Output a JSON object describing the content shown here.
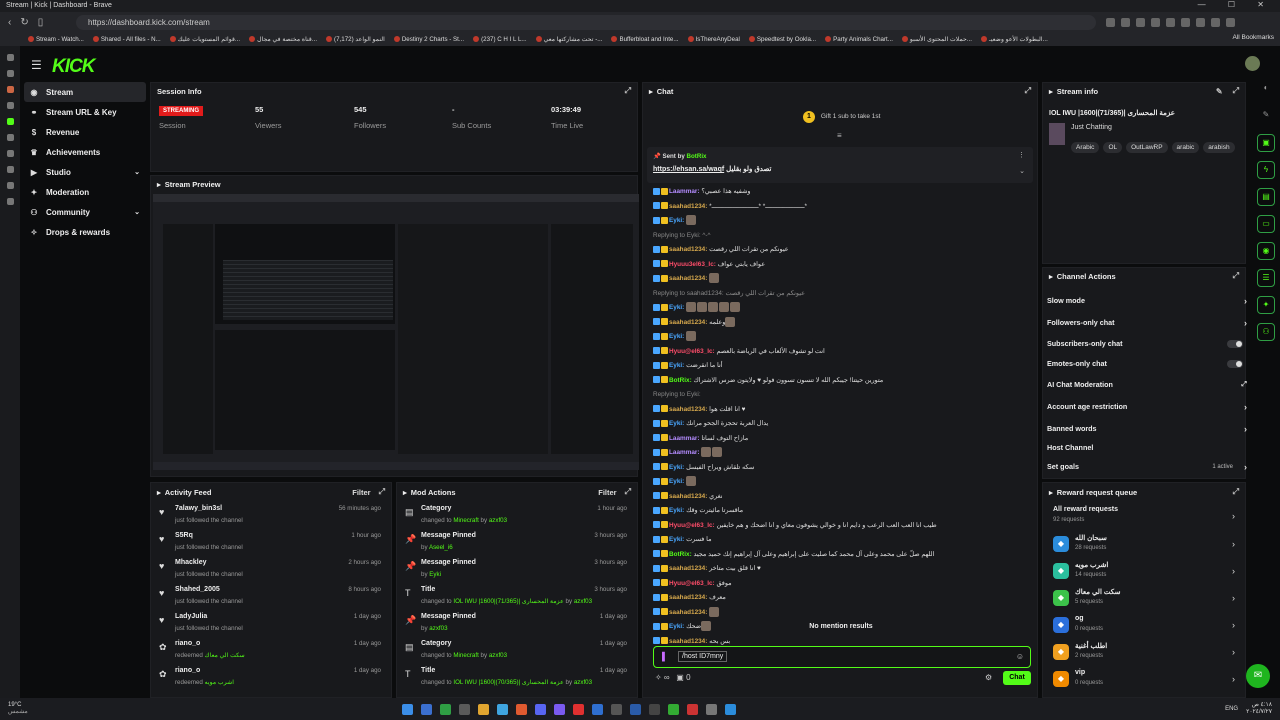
{
  "browser": {
    "title": "Stream | Kick | Dashboard - Brave",
    "url": "https://dashboard.kick.com/stream",
    "bookmarks": [
      "Stream - Watch...",
      "Shared - All files - N...",
      "قوائم المستويات عليك...",
      "قناة مختصة في مجال...",
      "النمو الواعد (7,172)",
      "Destiny 2 Charts - St...",
      "(237) C H I L L...",
      "تحت مشاركتها معي -...",
      "Bufferbloat and Inte...",
      "IsThereAnyDeal",
      "Speedtest by Ookla...",
      "Party Animals Chart...",
      "حملات المحتوى الأسبو...",
      "البطولات الأعو وضعيـ..."
    ],
    "all_bookmarks": "All Bookmarks"
  },
  "sidebar": {
    "items": [
      {
        "label": "Stream",
        "icon": "signal"
      },
      {
        "label": "Stream URL & Key",
        "icon": "link"
      },
      {
        "label": "Revenue",
        "icon": "dollar"
      },
      {
        "label": "Achievements",
        "icon": "trophy"
      },
      {
        "label": "Studio",
        "icon": "studio"
      },
      {
        "label": "Moderation",
        "icon": "sword"
      },
      {
        "label": "Community",
        "icon": "users"
      },
      {
        "label": "Drops & rewards",
        "icon": "gift"
      }
    ]
  },
  "session": {
    "title": "Session Info",
    "status": "STREAMING",
    "status_label": "Session",
    "viewers": "55",
    "viewers_label": "Viewers",
    "followers": "545",
    "followers_label": "Followers",
    "subs": "-",
    "subs_label": "Sub Counts",
    "time": "03:39:49",
    "time_label": "Time Live"
  },
  "preview": {
    "title": "Stream Preview"
  },
  "activity": {
    "title": "Activity Feed",
    "filter": "Filter",
    "items": [
      {
        "name": "7alawy_bin3sl",
        "sub": "just followed the channel",
        "time": "56 minutes ago",
        "icon": "heart"
      },
      {
        "name": "S5Rq",
        "sub": "just followed the channel",
        "time": "1 hour ago",
        "icon": "heart"
      },
      {
        "name": "Mhackley",
        "sub": "just followed the channel",
        "time": "2 hours ago",
        "icon": "heart"
      },
      {
        "name": "Shahed_2005",
        "sub": "just followed the channel",
        "time": "8 hours ago",
        "icon": "heart"
      },
      {
        "name": "LadyJulia",
        "sub": "just followed the channel",
        "time": "1 day ago",
        "icon": "heart"
      },
      {
        "name": "riano_o",
        "sub_prefix": "redeemed",
        "sub_green": "سكت الي معاك",
        "time": "1 day ago",
        "icon": "reward"
      },
      {
        "name": "riano_o",
        "sub_prefix": "redeemed",
        "sub_green": "اشرب مويه",
        "time": "1 day ago",
        "icon": "reward"
      }
    ]
  },
  "modactions": {
    "title": "Mod Actions",
    "filter": "Filter",
    "items": [
      {
        "name": "Category",
        "pre": "changed to",
        "green": "Minecraft",
        "by": "by",
        "who": "azxf03",
        "time": "1 hour ago",
        "icon": "category"
      },
      {
        "name": "Message Pinned",
        "pre": "",
        "green": "",
        "by": "by",
        "who": "Aseel_i6",
        "time": "3 hours ago",
        "icon": "pin"
      },
      {
        "name": "Message Pinned",
        "pre": "",
        "green": "",
        "by": "by",
        "who": "Eyki",
        "time": "3 hours ago",
        "icon": "pin"
      },
      {
        "name": "Title",
        "pre": "changed to",
        "green": "IOL IWU |1600|(71/365)| عزمة المحسارى",
        "by": "by",
        "who": "azxf03",
        "time": "3 hours ago",
        "icon": "title"
      },
      {
        "name": "Message Pinned",
        "pre": "",
        "green": "",
        "by": "by",
        "who": "azxf03",
        "time": "1 day ago",
        "icon": "pin"
      },
      {
        "name": "Category",
        "pre": "changed to",
        "green": "Minecraft",
        "by": "by",
        "who": "azxf03",
        "time": "1 day ago",
        "icon": "category"
      },
      {
        "name": "Title",
        "pre": "changed to",
        "green": "IOL IWU |1600|(70/365)| عزمة المحسارى",
        "by": "by",
        "who": "azxf03",
        "time": "1 day ago",
        "icon": "title"
      }
    ]
  },
  "chat": {
    "title": "Chat",
    "gift_text": "Gift 1 sub to take 1st",
    "gift_count": "1",
    "pinned_label": "Sent by",
    "pinned_by": "BotRix",
    "pinned_url": "https://ehsan.sa/waqf",
    "pinned_text": "تصدق ولو بقليل",
    "messages": [
      {
        "user": "Laammar:",
        "color": "#b48cff",
        "text": "وشفيه هذا عصبي؟"
      },
      {
        "user": "saahad1234:",
        "color": "#d7a94d",
        "text": "*ـــــــــــــــــــــ* *ـــــــــــــــــــــــــ*"
      },
      {
        "user": "Eyki:",
        "color": "#4aa7ff",
        "text": "",
        "emotes": 1
      },
      {
        "user": "",
        "color": "#777",
        "text": "Replying to Eyki: ^-^"
      },
      {
        "user": "saahad1234:",
        "color": "#d7a94d",
        "text": "عيونكم من تقرات اللي رقصت"
      },
      {
        "user": "Hyuuu3el63_Ic:",
        "color": "#ff4d6a",
        "text": "عواف يابتي عواف"
      },
      {
        "user": "saahad1234:",
        "color": "#d7a94d",
        "text": "",
        "emotes": 1
      },
      {
        "user": "",
        "color": "#777",
        "text": "Replying to saahad1234: عيونكم من تقرات اللي رقصت"
      },
      {
        "user": "Eyki:",
        "color": "#4aa7ff",
        "text": "",
        "emotes": 5
      },
      {
        "user": "saahad1234:",
        "color": "#d7a94d",
        "text": "وعلمه",
        "emotes": 1
      },
      {
        "user": "Eyki:",
        "color": "#4aa7ff",
        "text": "",
        "emotes": 1
      },
      {
        "user": "Hyuu@el63_Ic:",
        "color": "#ff4d6a",
        "text": "انت لو تشوف الألعاب في الرياضة بالعصم"
      },
      {
        "user": "Eyki:",
        "color": "#4aa7ff",
        "text": "أنا ما انقرضت"
      },
      {
        "user": "BotRix:",
        "color": "#53fc18",
        "text": "متورين حيتنا! جيبكم الله لا تنسون تسوون فولو ♥ ولايتون ضرس الاشتراك"
      },
      {
        "user": "",
        "color": "#777",
        "text": "Replying to Eyki:"
      },
      {
        "user": "saahad1234:",
        "color": "#d7a94d",
        "text": "انا اقلت هوا ♥"
      },
      {
        "user": "Eyki:",
        "color": "#4aa7ff",
        "text": "يدال العربة تحجزة الجحو مرانك"
      },
      {
        "user": "Laammar:",
        "color": "#b48cff",
        "text": "مازاح التوف لساتا"
      },
      {
        "user": "Laammar:",
        "color": "#b48cff",
        "text": "",
        "emotes": 2
      },
      {
        "user": "Eyki:",
        "color": "#4aa7ff",
        "text": "سكه تلقاش ويراح الفيسل"
      },
      {
        "user": "Eyki:",
        "color": "#4aa7ff",
        "text": "",
        "emotes": 1
      },
      {
        "user": "saahad1234:",
        "color": "#d7a94d",
        "text": "نغري"
      },
      {
        "user": "Eyki:",
        "color": "#4aa7ff",
        "text": "ماقسرتا مائيترت وقك"
      },
      {
        "user": "Hyuu@el63_Ic:",
        "color": "#ff4d6a",
        "text": "طيب انا العب العب الرعب و دايم انا و خوالي يشوفون معاي و انا اضحك و هم خايفين"
      },
      {
        "user": "Eyki:",
        "color": "#4aa7ff",
        "text": "ما فسرت"
      },
      {
        "user": "BotRix:",
        "color": "#53fc18",
        "text": "اللهم صلّ على محمد وعلى آل محمد كما صليت على إبراهيم وعلى آل إبراهيم إنك حميد مجيد"
      },
      {
        "user": "saahad1234:",
        "color": "#d7a94d",
        "text": "انا قلق بيت متاخر ♥"
      },
      {
        "user": "Hyuu@el63_Ic:",
        "color": "#ff4d6a",
        "text": "موفق"
      },
      {
        "user": "saahad1234:",
        "color": "#d7a94d",
        "text": "معرف"
      },
      {
        "user": "saahad1234:",
        "color": "#d7a94d",
        "text": "",
        "emotes": 1
      },
      {
        "user": "Eyki:",
        "color": "#4aa7ff",
        "text": "ضحك",
        "emotes": 1
      },
      {
        "user": "saahad1234:",
        "color": "#d7a94d",
        "text": "بس بحه"
      }
    ],
    "no_mention": "No mention results",
    "input_value": "/host ID7mny",
    "send": "Chat",
    "count": "0"
  },
  "streaminfo": {
    "title": "Stream info",
    "stream_title": "IOL IWU |1600|(71/365)| عزمة المحسارى",
    "category": "Just Chatting",
    "tags": [
      "Arabic",
      "OL",
      "OutLawRP",
      "arabic",
      "arabish"
    ]
  },
  "channelactions": {
    "title": "Channel Actions",
    "items": [
      {
        "label": "Slow mode",
        "type": "chevron"
      },
      {
        "label": "Followers-only chat",
        "type": "chevron"
      },
      {
        "label": "Subscribers-only chat",
        "type": "toggle"
      },
      {
        "label": "Emotes-only chat",
        "type": "toggle"
      },
      {
        "label": "AI Chat Moderation",
        "type": "external"
      },
      {
        "label": "Account age restriction",
        "type": "chevron"
      },
      {
        "label": "Banned words",
        "type": "chevron"
      },
      {
        "label": "Host Channel",
        "type": "none"
      },
      {
        "label": "Set goals",
        "type": "chevron",
        "extra": "1 active"
      }
    ]
  },
  "rewards": {
    "title": "Reward request queue",
    "all_label": "All reward requests",
    "all_count": "92 requests",
    "items": [
      {
        "name": "سبحان الله",
        "count": "28 requests",
        "color": "#2b8cdb"
      },
      {
        "name": "اشرب مويه",
        "count": "14 requests",
        "color": "#2bbf9e"
      },
      {
        "name": "سكت الي معاك",
        "count": "5 requests",
        "color": "#3cc24a"
      },
      {
        "name": "og",
        "count": "0 requests",
        "color": "#2b6fdb"
      },
      {
        "name": "اطلب أغنية",
        "count": "2 requests",
        "color": "#f0a020"
      },
      {
        "name": "vip",
        "count": "0 requests",
        "color": "#f08a00"
      }
    ]
  },
  "taskbar": {
    "weather": "19°C",
    "weather_sub": "مشمس",
    "lang": "ENG",
    "time": "٤:١٨ ص",
    "date": "٢٠٢٤/٧/٢٧"
  }
}
